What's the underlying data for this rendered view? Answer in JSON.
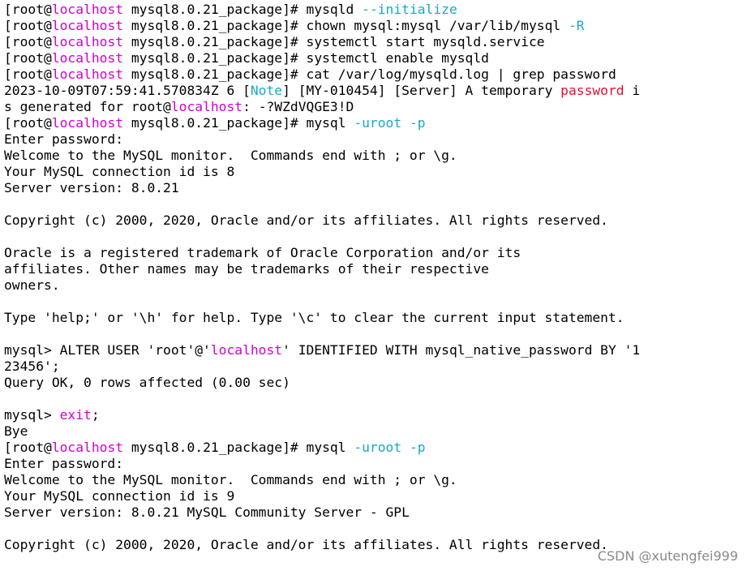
{
  "terminal": {
    "lines": [
      [
        {
          "t": "[root@",
          "c": "d"
        },
        {
          "t": "localhost",
          "c": "m"
        },
        {
          "t": " mysql8.0.21_package]# mysqld ",
          "c": "d"
        },
        {
          "t": "--initialize",
          "c": "c"
        }
      ],
      [
        {
          "t": "[root@",
          "c": "d"
        },
        {
          "t": "localhost",
          "c": "m"
        },
        {
          "t": " mysql8.0.21_package]# chown mysql:mysql /var/lib/mysql ",
          "c": "d"
        },
        {
          "t": "-R",
          "c": "c"
        }
      ],
      [
        {
          "t": "[root@",
          "c": "d"
        },
        {
          "t": "localhost",
          "c": "m"
        },
        {
          "t": " mysql8.0.21_package]# systemctl start mysqld.service",
          "c": "d"
        }
      ],
      [
        {
          "t": "[root@",
          "c": "d"
        },
        {
          "t": "localhost",
          "c": "m"
        },
        {
          "t": " mysql8.0.21_package]# systemctl enable mysqld",
          "c": "d"
        }
      ],
      [
        {
          "t": "[root@",
          "c": "d"
        },
        {
          "t": "localhost",
          "c": "m"
        },
        {
          "t": " mysql8.0.21_package]# cat /var/log/mysqld.log | grep password",
          "c": "d"
        }
      ],
      [
        {
          "t": "2023-10-09T07:59:41.570834Z 6 [",
          "c": "d"
        },
        {
          "t": "Note",
          "c": "c"
        },
        {
          "t": "] [MY-010454] [Server] A temporary ",
          "c": "d"
        },
        {
          "t": "password",
          "c": "r"
        },
        {
          "t": " i",
          "c": "d"
        }
      ],
      [
        {
          "t": "s generated for root@",
          "c": "d"
        },
        {
          "t": "localhost",
          "c": "m"
        },
        {
          "t": ": -?WZdVQGE3!D",
          "c": "d"
        }
      ],
      [
        {
          "t": "[root@",
          "c": "d"
        },
        {
          "t": "localhost",
          "c": "m"
        },
        {
          "t": " mysql8.0.21_package]# mysql ",
          "c": "d"
        },
        {
          "t": "-uroot",
          "c": "c"
        },
        {
          "t": " ",
          "c": "d"
        },
        {
          "t": "-p",
          "c": "c"
        }
      ],
      [
        {
          "t": "Enter password:",
          "c": "d"
        }
      ],
      [
        {
          "t": "Welcome to the MySQL monitor.  Commands end with ; or \\g.",
          "c": "d"
        }
      ],
      [
        {
          "t": "Your MySQL connection id is 8",
          "c": "d"
        }
      ],
      [
        {
          "t": "Server version: 8.0.21",
          "c": "d"
        }
      ],
      [],
      [
        {
          "t": "Copyright (c) 2000, 2020, Oracle and/or its affiliates. All rights reserved.",
          "c": "d"
        }
      ],
      [],
      [
        {
          "t": "Oracle is a registered trademark of Oracle Corporation and/or its",
          "c": "d"
        }
      ],
      [
        {
          "t": "affiliates. Other names may be trademarks of their respective",
          "c": "d"
        }
      ],
      [
        {
          "t": "owners.",
          "c": "d"
        }
      ],
      [],
      [
        {
          "t": "Type 'help;' or '\\h' for help. Type '\\c' to clear the current input statement.",
          "c": "d"
        }
      ],
      [],
      [
        {
          "t": "mysql> ALTER USER 'root'@'",
          "c": "d"
        },
        {
          "t": "localhost",
          "c": "m"
        },
        {
          "t": "' IDENTIFIED WITH mysql_native_password BY '1",
          "c": "d"
        }
      ],
      [
        {
          "t": "23456';",
          "c": "d"
        }
      ],
      [
        {
          "t": "Query OK, 0 rows affected (0.00 sec)",
          "c": "d"
        }
      ],
      [],
      [
        {
          "t": "mysql> ",
          "c": "d"
        },
        {
          "t": "exit",
          "c": "m"
        },
        {
          "t": ";",
          "c": "d"
        }
      ],
      [
        {
          "t": "Bye",
          "c": "d"
        }
      ],
      [
        {
          "t": "[root@",
          "c": "d"
        },
        {
          "t": "localhost",
          "c": "m"
        },
        {
          "t": " mysql8.0.21_package]# mysql ",
          "c": "d"
        },
        {
          "t": "-uroot",
          "c": "c"
        },
        {
          "t": " ",
          "c": "d"
        },
        {
          "t": "-p",
          "c": "c"
        }
      ],
      [
        {
          "t": "Enter password:",
          "c": "d"
        }
      ],
      [
        {
          "t": "Welcome to the MySQL monitor.  Commands end with ; or \\g.",
          "c": "d"
        }
      ],
      [
        {
          "t": "Your MySQL connection id is 9",
          "c": "d"
        }
      ],
      [
        {
          "t": "Server version: 8.0.21 MySQL Community Server - GPL",
          "c": "d"
        }
      ],
      [],
      [
        {
          "t": "Copyright (c) 2000, 2020, Oracle and/or its affiliates. All rights reserved.",
          "c": "d"
        }
      ]
    ],
    "colors": {
      "default": "#000000",
      "magenta": "#d000d0",
      "cyan": "#1aa7c7",
      "red": "#e01030",
      "background": "#ffffff"
    }
  },
  "watermark": {
    "text": "CSDN @xutengfei999"
  }
}
